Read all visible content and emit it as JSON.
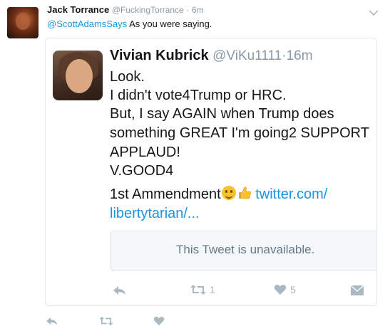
{
  "tweet": {
    "author_name": "Jack Torrance",
    "author_handle": "@FuckingTorrance",
    "separator": "·",
    "time": "6m",
    "mention": "@ScottAdamsSays",
    "text": " As you were saying.",
    "actions": {
      "reply_icon": "reply-icon",
      "retweet_icon": "retweet-icon",
      "like_icon": "heart-icon"
    }
  },
  "quoted": {
    "author_name": "Vivian Kubrick",
    "author_handle": "@ViKu1111",
    "separator": "·",
    "time": "16m",
    "lines": [
      "Look.",
      "I didn't vote4Trump or HRC.",
      "But, I say AGAIN when Trump does",
      "something GREAT I'm going2 SUPPORT",
      "APPLAUD!",
      "V.GOOD4"
    ],
    "last_line_prefix": "1st Ammendment",
    "link_part1": "twitter.com/",
    "link_part2": "libertytarian/...",
    "unavailable_text": "This Tweet is unavailable.",
    "retweet_count": "1",
    "like_count": "5"
  },
  "colors": {
    "accent": "#1b95e0",
    "muted": "#8899a6",
    "icon": "#aab8c2",
    "border": "#e1e8ed"
  }
}
